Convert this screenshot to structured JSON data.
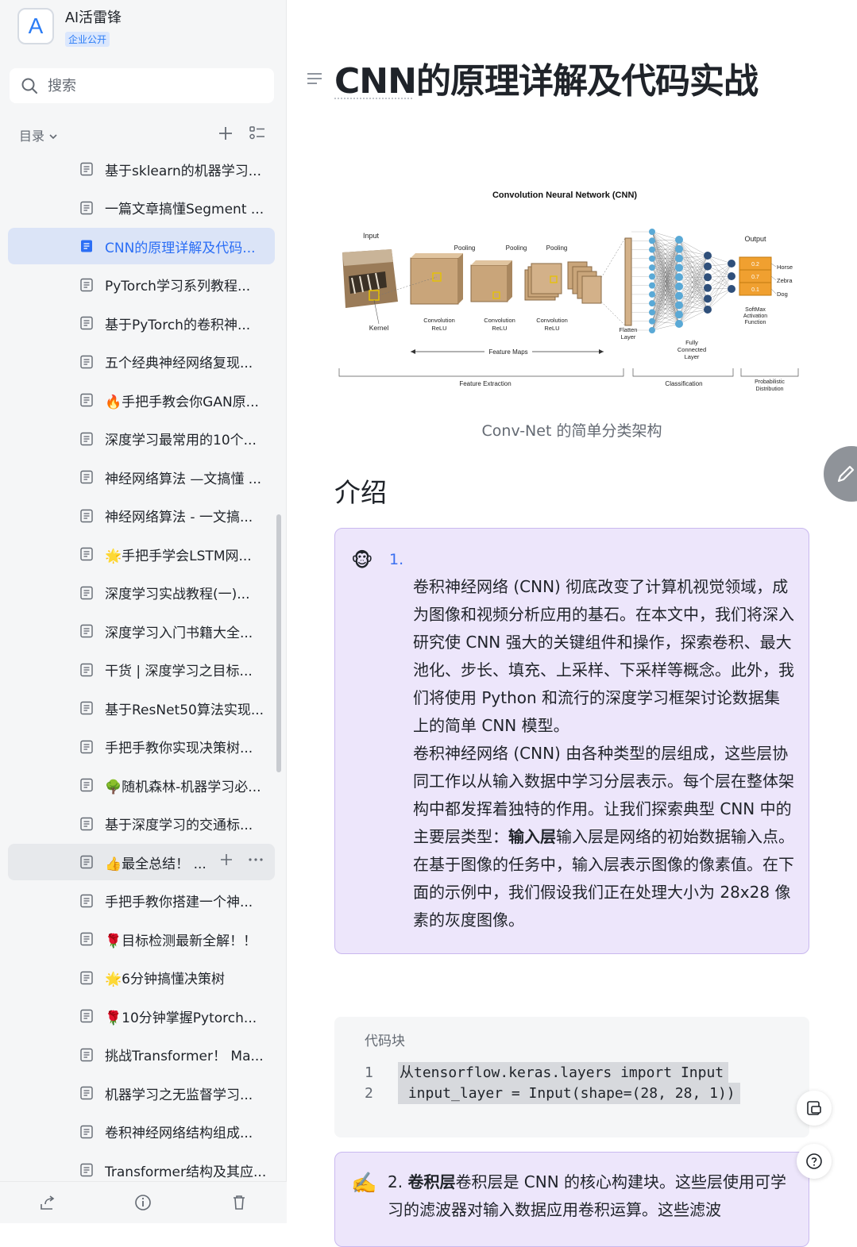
{
  "space": {
    "logo_letter": "A",
    "name": "AI活雷锋",
    "badge": "企业公开"
  },
  "search": {
    "placeholder": "搜索"
  },
  "toc": {
    "label": "目录"
  },
  "documents": [
    {
      "title": "基于sklearn的机器学习..."
    },
    {
      "title": "一篇文章搞懂Segment ..."
    },
    {
      "title": "CNN的原理详解及代码..."
    },
    {
      "title": "PyTorch学习系列教程..."
    },
    {
      "title": "基于PyTorch的卷积神..."
    },
    {
      "title": "五个经典神经网络复现..."
    },
    {
      "title": "🔥手把手教会你GAN原..."
    },
    {
      "title": "深度学习最常用的10个..."
    },
    {
      "title": "神经网络算法 —文搞懂 ..."
    },
    {
      "title": "神经网络算法 - 一文搞..."
    },
    {
      "title": "🌟手把手学会LSTM网..."
    },
    {
      "title": "深度学习实战教程(一)..."
    },
    {
      "title": "深度学习入门书籍大全..."
    },
    {
      "title": "干货 | 深度学习之目标..."
    },
    {
      "title": "基于ResNet50算法实现..."
    },
    {
      "title": "手把手教你实现决策树..."
    },
    {
      "title": "🌳随机森林-机器学习必..."
    },
    {
      "title": "基于深度学习的交通标..."
    },
    {
      "title": "👍最全总结！ ..."
    },
    {
      "title": "手把手教你搭建一个神..."
    },
    {
      "title": "🌹目标检测最新全解！！"
    },
    {
      "title": "🌟6分钟搞懂决策树"
    },
    {
      "title": "🌹10分钟掌握Pytorch..."
    },
    {
      "title": "挑战Transformer！ Ma..."
    },
    {
      "title": "机器学习之无监督学习..."
    },
    {
      "title": "卷积神经网络结构组成..."
    },
    {
      "title": "Transformer结构及其应..."
    }
  ],
  "doc": {
    "title": "CNN的原理详解及代码实战",
    "figure": {
      "title": "Convolution  Neural  Network (CNN)",
      "input": "Input",
      "output": "Output",
      "kernel": "Kernel",
      "pooling": "Pooling",
      "conv": "Convolution",
      "relu": "ReLU",
      "flatten1": "Flatten",
      "flatten2": "Layer",
      "fc1": "Fully",
      "fc2": "Connected",
      "fc3": "Layer",
      "feature_maps": "Feature Maps",
      "softmax1": "SoftMax",
      "softmax2": "Activation",
      "softmax3": "Function",
      "classes": [
        "Horse",
        "Zebra",
        "Dog"
      ],
      "probs": [
        "0.2",
        "0.7",
        "0.1"
      ],
      "feature_extraction": "Feature Extraction",
      "classification": "Classification",
      "prob1": "Probabilistic",
      "prob2": "Distribution"
    },
    "caption": "Conv-Net 的简单分类架构",
    "h2": "介绍",
    "callout1": {
      "emoji": "🐵",
      "number": "1.",
      "para1": "卷积神经网络 (CNN) 彻底改变了计算机视觉领域，成为图像和视频分析应用的基石。在本文中，我们将深入研究使 CNN 强大的关键组件和操作，探索卷积、最大池化、步长、填充、上采样、下采样等概念。此外，我们将使用 Python 和流行的深度学习框架讨论数据集上的简单 CNN 模型。",
      "para2_a": "卷积神经网络 (CNN) 由各种类型的层组成，这些层协同工作以从输入数据中学习分层表示。每个层在整体架构中都发挥着独特的作用。让我们探索典型 CNN 中的主要层类型：",
      "para2_bold": "输入层",
      "para2_b": "输入层是网络的初始数据输入点。在基于图像的任务中，输入层表示图像的像素值。在下面的示例中，我们假设我们正在处理大小为 28x28 像素的灰度图像。"
    },
    "code": {
      "label": "代码块",
      "lines": [
        {
          "num": "1",
          "text": "从tensorflow.keras.layers import Input"
        },
        {
          "num": "2",
          "text": " input_layer = Input(shape=(28, 28, 1))"
        }
      ]
    },
    "callout2": {
      "emoji": "✍️",
      "prefix": "2. ",
      "bold": "卷积层",
      "text": "卷积层是 CNN 的核心构建块。这些层使用可学习的滤波器对输入数据应用卷积运算。这些滤波"
    }
  },
  "colors": {
    "accent": "#2b6ef5",
    "callout_bg": "#ede6fb",
    "callout_border": "#c9b8ef",
    "sidebar_bg": "#f5f6f7"
  }
}
